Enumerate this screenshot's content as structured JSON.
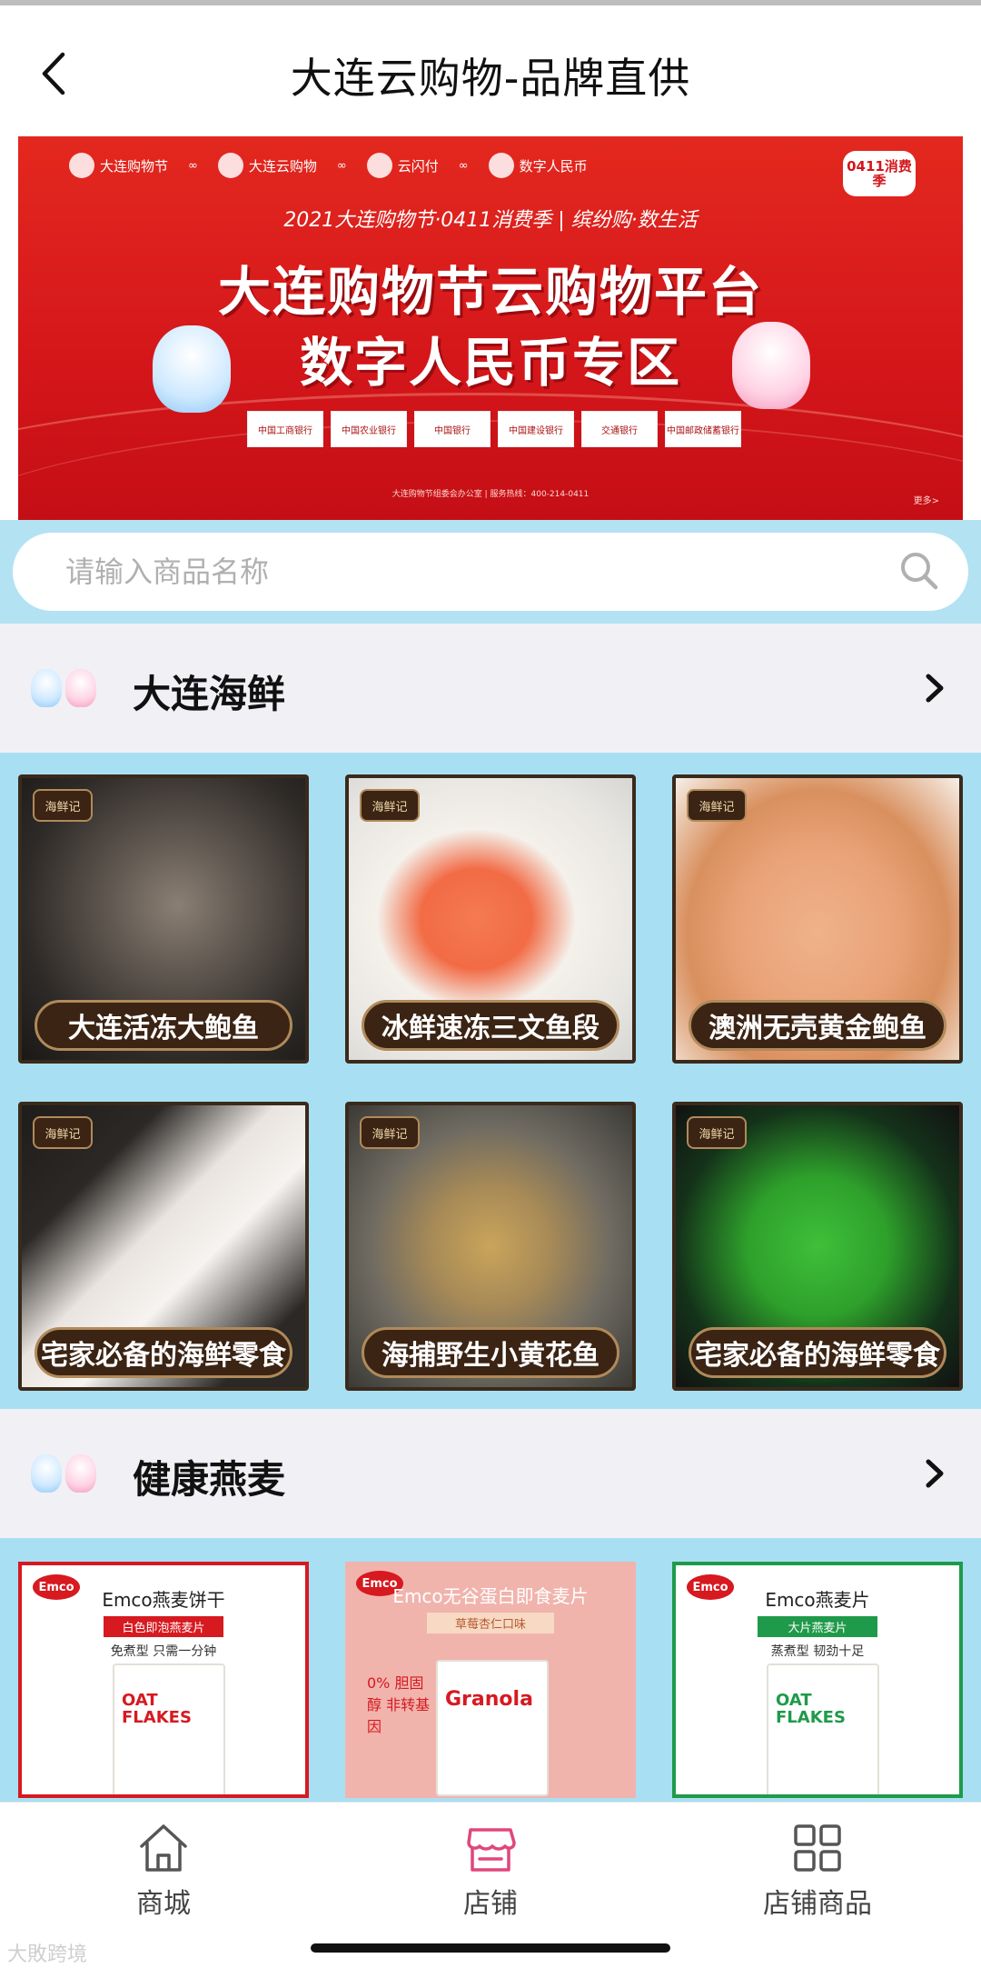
{
  "nav": {
    "title": "大连云购物-品牌直供"
  },
  "banner": {
    "partners": [
      "大连购物节",
      "大连云购物",
      "云闪付",
      "数字人民币"
    ],
    "season_badge": "0411消费季",
    "slogan": "2021大连购物节·0411消费季 | 缤纷购·数生活",
    "line1": "大连购物节云购物平台",
    "line2": "数字人民币专区",
    "banks": [
      "中国工商银行",
      "中国农业银行",
      "中国银行",
      "中国建设银行",
      "交通银行",
      "中国邮政储蓄银行"
    ],
    "footer": "大连购物节组委会办公室 | 服务热线：400-214-0411",
    "corner": "更多>"
  },
  "search": {
    "placeholder": "请输入商品名称"
  },
  "sections": [
    {
      "title": "大连海鲜",
      "products": [
        {
          "label": "大连活冻大鲍鱼",
          "tag": "海鲜记"
        },
        {
          "label": "冰鲜速冻三文鱼段",
          "tag": "海鲜记"
        },
        {
          "label": "澳洲无壳黄金鲍鱼",
          "tag": "海鲜记"
        },
        {
          "label": "宅家必备的海鲜零食",
          "tag": "海鲜记"
        },
        {
          "label": "海捕野生小黄花鱼",
          "tag": "海鲜记"
        },
        {
          "label": "宅家必备的海鲜零食",
          "tag": "海鲜记"
        }
      ]
    },
    {
      "title": "健康燕麦",
      "products": [
        {
          "brand": "Emco",
          "title": "Emco燕麦饼干",
          "sub": "白色即泡燕麦片",
          "note": "免煮型  只需一分钟",
          "box": "OAT FLAKES"
        },
        {
          "brand": "Emco",
          "title": "Emco无谷蛋白即食麦片",
          "sub": "草莓杏仁口味",
          "note": "0% 胆固醇  非转基因",
          "box": "Granola"
        },
        {
          "brand": "Emco",
          "title": "Emco燕麦片",
          "sub": "大片燕麦片",
          "note": "蒸煮型  韧劲十足",
          "box": "OAT FLAKES"
        }
      ]
    }
  ],
  "tabbar": {
    "items": [
      {
        "label": "商城",
        "icon": "home-icon"
      },
      {
        "label": "店铺",
        "icon": "store-icon"
      },
      {
        "label": "店铺商品",
        "icon": "grid-icon"
      }
    ]
  },
  "watermark": "大敗跨境",
  "colors": {
    "accent": "#d71920",
    "search_bg": "#b3e2f2",
    "product_bg": "#a9dff2",
    "store_icon": "#e0467c"
  }
}
